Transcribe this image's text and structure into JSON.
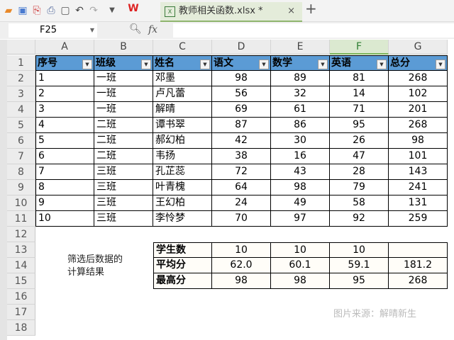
{
  "toolbar": {
    "tab_title": "教师相关函数.xlsx *",
    "close": "×",
    "new_tab": "+"
  },
  "formula_bar": {
    "name_box": "F25",
    "fx": "fx",
    "value": ""
  },
  "columns": [
    "A",
    "B",
    "C",
    "D",
    "E",
    "F",
    "G"
  ],
  "rows": [
    "1",
    "2",
    "3",
    "4",
    "5",
    "6",
    "7",
    "8",
    "9",
    "10",
    "11",
    "12",
    "13",
    "14",
    "15",
    "16",
    "17",
    "18"
  ],
  "table": {
    "headers": [
      "序号",
      "班级",
      "姓名",
      "语文",
      "数学",
      "英语",
      "总分"
    ],
    "data": [
      [
        "1",
        "一班",
        "邓墨",
        "98",
        "89",
        "81",
        "268"
      ],
      [
        "2",
        "一班",
        "卢凡蕾",
        "56",
        "32",
        "14",
        "102"
      ],
      [
        "3",
        "一班",
        "解晴",
        "69",
        "61",
        "71",
        "201"
      ],
      [
        "4",
        "二班",
        "谭书翠",
        "87",
        "86",
        "95",
        "268"
      ],
      [
        "5",
        "二班",
        "郝幻柏",
        "42",
        "30",
        "26",
        "98"
      ],
      [
        "6",
        "二班",
        "韦扬",
        "38",
        "16",
        "47",
        "101"
      ],
      [
        "7",
        "三班",
        "孔芷蕊",
        "72",
        "43",
        "28",
        "143"
      ],
      [
        "8",
        "三班",
        "叶青槐",
        "64",
        "98",
        "79",
        "241"
      ],
      [
        "9",
        "三班",
        "王幻柏",
        "24",
        "49",
        "58",
        "131"
      ],
      [
        "10",
        "三班",
        "李怜梦",
        "70",
        "97",
        "92",
        "259"
      ]
    ]
  },
  "summary": {
    "note_line1": "筛选后数据的",
    "note_line2": "计算结果",
    "rows": [
      [
        "学生数",
        "10",
        "10",
        "10",
        ""
      ],
      [
        "平均分",
        "62.0",
        "60.1",
        "59.1",
        "181.2"
      ],
      [
        "最高分",
        "98",
        "98",
        "95",
        "268"
      ]
    ]
  },
  "watermark": "图片来源：解晴新生"
}
